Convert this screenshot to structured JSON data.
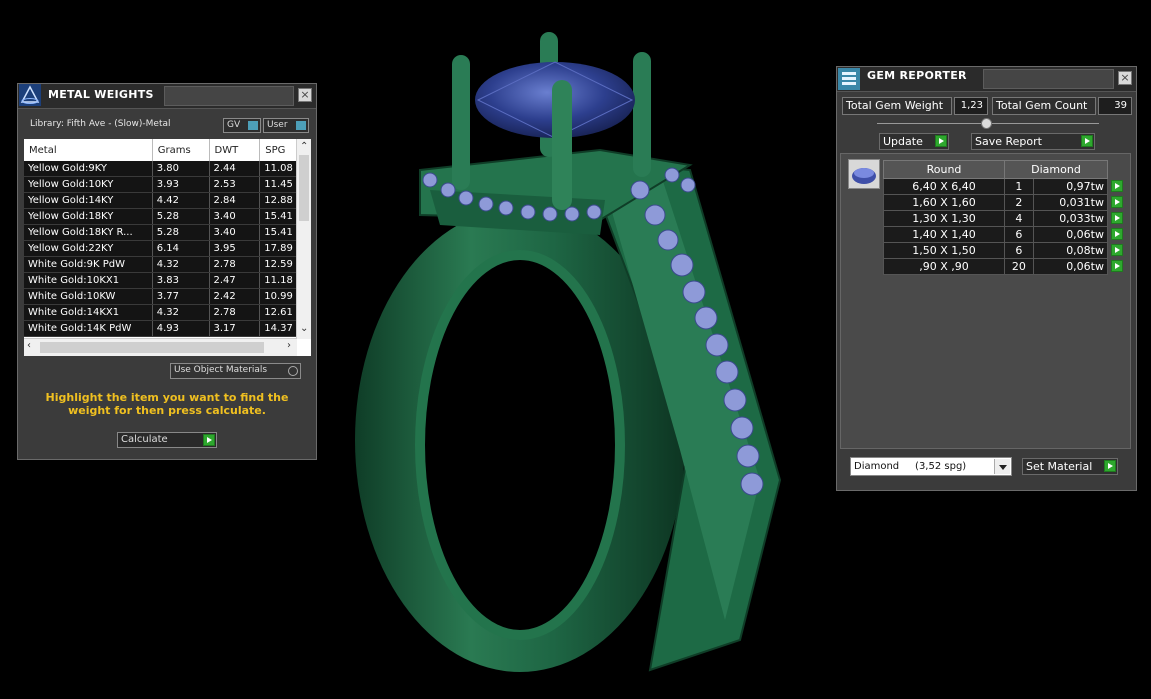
{
  "metal_weights": {
    "title": "METAL WEIGHTS",
    "library_label": "Library: Fifth Ave - (Slow)-Metal",
    "gv_label": "GV",
    "user_label": "User",
    "columns": [
      "Metal",
      "Grams",
      "DWT",
      "SPG"
    ],
    "rows": [
      [
        "Yellow Gold:9KY",
        "3.80",
        "2.44",
        "11.08"
      ],
      [
        "Yellow Gold:10KY",
        "3.93",
        "2.53",
        "11.45"
      ],
      [
        "Yellow Gold:14KY",
        "4.42",
        "2.84",
        "12.88"
      ],
      [
        "Yellow Gold:18KY",
        "5.28",
        "3.40",
        "15.41"
      ],
      [
        "Yellow Gold:18KY R...",
        "5.28",
        "3.40",
        "15.41"
      ],
      [
        "Yellow Gold:22KY",
        "6.14",
        "3.95",
        "17.89"
      ],
      [
        "White Gold:9K PdW",
        "4.32",
        "2.78",
        "12.59"
      ],
      [
        "White Gold:10KX1",
        "3.83",
        "2.47",
        "11.18"
      ],
      [
        "White Gold:10KW",
        "3.77",
        "2.42",
        "10.99"
      ],
      [
        "White Gold:14KX1",
        "4.32",
        "2.78",
        "12.61"
      ],
      [
        "White Gold:14K PdW",
        "4.93",
        "3.17",
        "14.37"
      ]
    ],
    "use_object_materials_label": "Use Object Materials",
    "instruction": "Highlight the item you want to find the weight for then press calculate.",
    "calculate_label": "Calculate"
  },
  "gem_reporter": {
    "title": "GEM REPORTER",
    "total_gem_weight_label": "Total Gem Weight",
    "total_gem_weight_value": "1,23",
    "total_gem_count_label": "Total Gem Count",
    "total_gem_count_value": "39",
    "update_label": "Update",
    "save_report_label": "Save Report",
    "header_shape": "Round",
    "header_stone": "Diamond",
    "rows": [
      {
        "size": "6,40 X 6,40",
        "count": "1",
        "weight": "0,97tw"
      },
      {
        "size": "1,60 X 1,60",
        "count": "2",
        "weight": "0,031tw"
      },
      {
        "size": "1,30 X 1,30",
        "count": "4",
        "weight": "0,033tw"
      },
      {
        "size": "1,40 X 1,40",
        "count": "6",
        "weight": "0,06tw"
      },
      {
        "size": "1,50 X 1,50",
        "count": "6",
        "weight": "0,08tw"
      },
      {
        "size": ",90 X ,90",
        "count": "20",
        "weight": "0,06tw"
      }
    ],
    "material_select": "Diamond     (3,52 spg)",
    "set_material_label": "Set Material"
  },
  "colors": {
    "ring_green": "#1f6b45",
    "gem_blue": "#2c3e8a",
    "accent_go": "#2ea82e",
    "instruction_yellow": "#f0c020"
  }
}
